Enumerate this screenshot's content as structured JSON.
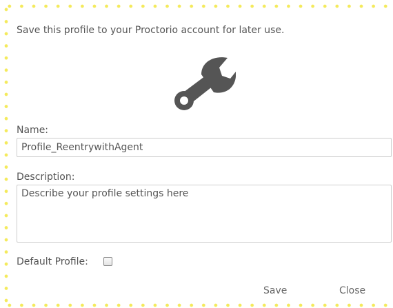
{
  "dialog": {
    "intro_text": "Save this profile to your Proctorio account for later use.",
    "icon": "wrench-icon",
    "name_label": "Name:",
    "name_value": "Profile_ReentrywithAgent",
    "description_label": "Description:",
    "description_placeholder": "Describe your profile settings here",
    "default_profile_label": "Default Profile:",
    "default_profile_checked": false,
    "save_label": "Save",
    "close_label": "Close"
  },
  "colors": {
    "border_dots": "#f4ea5c",
    "text": "#555555",
    "icon": "#555555"
  }
}
